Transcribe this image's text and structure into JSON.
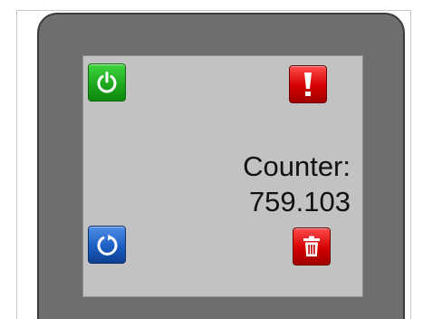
{
  "counter": {
    "label": "Counter:",
    "value": "759.103"
  },
  "buttons": {
    "power": {
      "icon": "power-icon",
      "color": "#1fa81f"
    },
    "alert": {
      "icon": "exclamation-icon",
      "color": "#d40000"
    },
    "refresh": {
      "icon": "refresh-icon",
      "color": "#1b5fc4"
    },
    "trash": {
      "icon": "trash-icon",
      "color": "#d40000"
    }
  },
  "colors": {
    "device": "#6e6e6e",
    "screen": "#c2c2c2"
  }
}
